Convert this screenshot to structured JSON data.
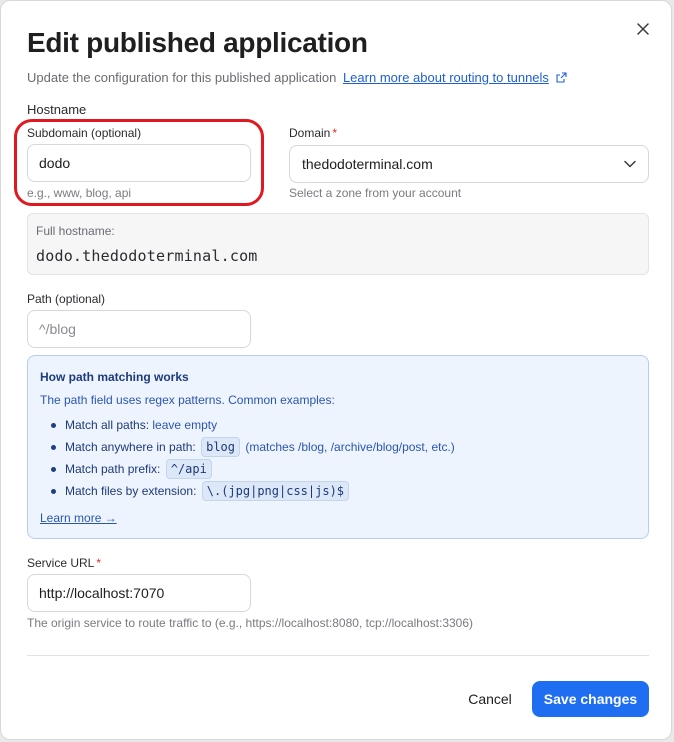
{
  "dialog": {
    "title": "Edit published application",
    "subtitle": "Update the configuration for this published application",
    "learn_more_routing": "Learn more about routing to tunnels"
  },
  "hostname": {
    "section_label": "Hostname",
    "subdomain": {
      "label": "Subdomain (optional)",
      "value": "dodo",
      "help": "e.g., www, blog, api"
    },
    "domain": {
      "label": "Domain",
      "required_mark": "*",
      "value": "thedodoterminal.com",
      "help": "Select a zone from your account"
    },
    "full_hostname": {
      "label": "Full hostname:",
      "value": "dodo.thedodoterminal.com"
    }
  },
  "path": {
    "label": "Path (optional)",
    "placeholder": "^/blog"
  },
  "path_info": {
    "title": "How path matching works",
    "description": "The path field uses regex patterns. Common examples:",
    "examples": [
      {
        "term": "Match all paths:",
        "detail": "leave empty"
      },
      {
        "term": "Match anywhere in path:",
        "code": "blog",
        "detail": "(matches /blog, /archive/blog/post, etc.)"
      },
      {
        "term": "Match path prefix:",
        "code": "^/api"
      },
      {
        "term": "Match files by extension:",
        "code": "\\.(jpg|png|css|js)$"
      }
    ],
    "learn_more": "Learn more →"
  },
  "service": {
    "label": "Service URL",
    "required_mark": "*",
    "value": "http://localhost:7070",
    "help": "The origin service to route traffic to (e.g., https://localhost:8080, tcp://localhost:3306)"
  },
  "actions": {
    "cancel": "Cancel",
    "save": "Save changes"
  },
  "icons": {
    "close": "close-icon",
    "external_link": "external-link-icon",
    "dropdown": "chevron-down-icon"
  },
  "colors": {
    "primary": "#1f6ef2",
    "link": "#1f5fd6",
    "required": "#d93025",
    "annotation": "#e0181f",
    "info_bg": "#eef4fd"
  }
}
